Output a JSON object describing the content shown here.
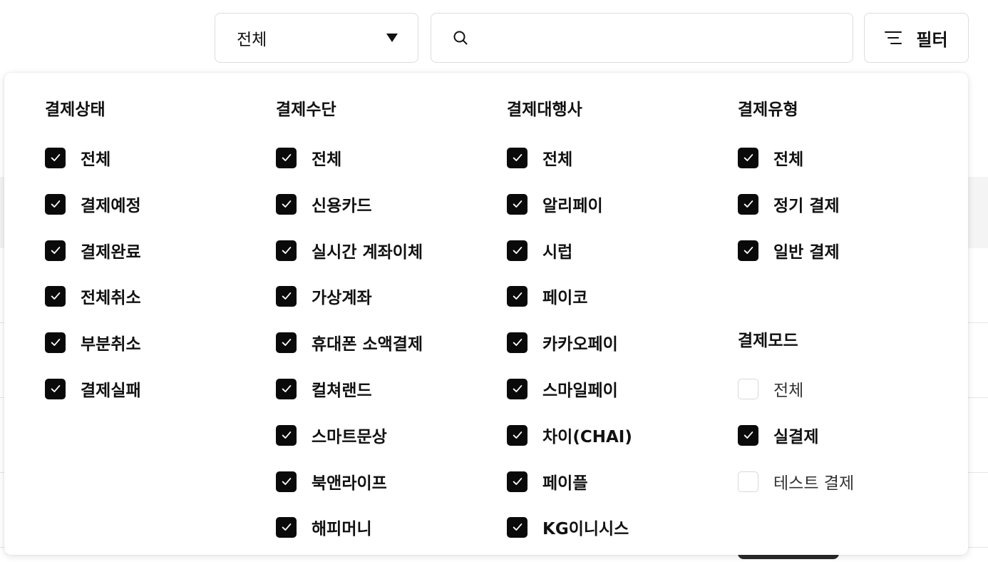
{
  "toolbar": {
    "scope_select": {
      "value": "전체"
    },
    "search": {
      "value": "",
      "placeholder": ""
    },
    "filter_button": {
      "label": "필터"
    }
  },
  "filter_panel": {
    "payment_status": {
      "title": "결제상태",
      "options": [
        {
          "label": "전체",
          "checked": true
        },
        {
          "label": "결제예정",
          "checked": true
        },
        {
          "label": "결제완료",
          "checked": true
        },
        {
          "label": "전체취소",
          "checked": true
        },
        {
          "label": "부분취소",
          "checked": true
        },
        {
          "label": "결제실패",
          "checked": true
        }
      ]
    },
    "payment_method": {
      "title": "결제수단",
      "options": [
        {
          "label": "전체",
          "checked": true
        },
        {
          "label": "신용카드",
          "checked": true
        },
        {
          "label": "실시간 계좌이체",
          "checked": true
        },
        {
          "label": "가상계좌",
          "checked": true
        },
        {
          "label": "휴대폰 소액결제",
          "checked": true
        },
        {
          "label": "컬쳐랜드",
          "checked": true
        },
        {
          "label": "스마트문상",
          "checked": true
        },
        {
          "label": "북앤라이프",
          "checked": true
        },
        {
          "label": "해피머니",
          "checked": true
        }
      ]
    },
    "payment_gateway": {
      "title": "결제대행사",
      "options": [
        {
          "label": "전체",
          "checked": true
        },
        {
          "label": "알리페이",
          "checked": true
        },
        {
          "label": "시럽",
          "checked": true
        },
        {
          "label": "페이코",
          "checked": true
        },
        {
          "label": "카카오페이",
          "checked": true
        },
        {
          "label": "스마일페이",
          "checked": true
        },
        {
          "label": "차이(CHAI)",
          "checked": true
        },
        {
          "label": "페이플",
          "checked": true
        },
        {
          "label": "KG이니시스",
          "checked": true
        }
      ]
    },
    "payment_type": {
      "title": "결제유형",
      "options": [
        {
          "label": "전체",
          "checked": true
        },
        {
          "label": "정기 결제",
          "checked": true
        },
        {
          "label": "일반 결제",
          "checked": true
        }
      ]
    },
    "payment_mode": {
      "title": "결제모드",
      "options": [
        {
          "label": "전체",
          "checked": false
        },
        {
          "label": "실결제",
          "checked": true
        },
        {
          "label": "테스트 결제",
          "checked": false
        }
      ]
    }
  }
}
